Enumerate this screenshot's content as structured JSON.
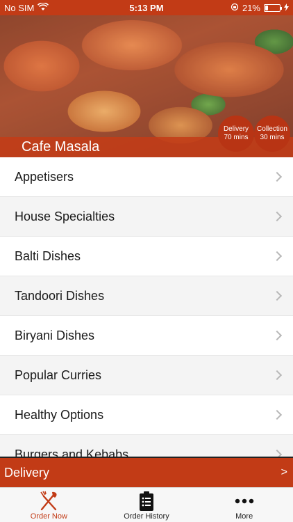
{
  "status_bar": {
    "carrier": "No SIM",
    "time": "5:13 PM",
    "battery_percent": "21%",
    "battery_level": 0.21
  },
  "hero": {
    "restaurant_name": "Cafe Masala",
    "delivery_badge": {
      "line1": "Delivery",
      "line2": "70 mins"
    },
    "collection_badge": {
      "line1": "Collection",
      "line2": "30 mins"
    }
  },
  "menu": {
    "items": [
      {
        "label": "Appetisers"
      },
      {
        "label": "House Specialties"
      },
      {
        "label": "Balti Dishes"
      },
      {
        "label": "Tandoori Dishes"
      },
      {
        "label": "Biryani Dishes"
      },
      {
        "label": "Popular Curries"
      },
      {
        "label": "Healthy Options"
      },
      {
        "label": "Burgers and Kebabs"
      }
    ]
  },
  "delivery_bar": {
    "label": "Delivery",
    "arrow": ">"
  },
  "tabs": [
    {
      "label": "Order Now",
      "icon": "fork-knife-icon",
      "active": true
    },
    {
      "label": "Order History",
      "icon": "clipboard-list-icon",
      "active": false
    },
    {
      "label": "More",
      "icon": "more-dots-icon",
      "active": false
    }
  ],
  "colors": {
    "accent": "#c23b16"
  }
}
